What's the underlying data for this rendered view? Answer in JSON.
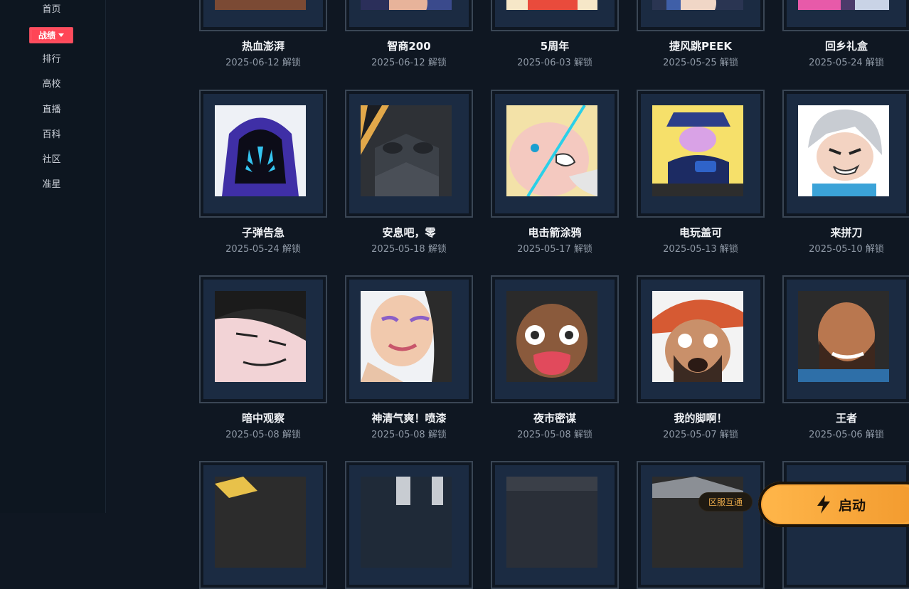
{
  "sidebar": {
    "items": [
      "首页",
      "战绩",
      "排行",
      "高校",
      "直播",
      "百科",
      "社区",
      "准星"
    ],
    "active": "战绩"
  },
  "cards": [
    {
      "title": "热血澎湃",
      "date": "2025-06-12 解锁",
      "icon": "portrait-brown"
    },
    {
      "title": "智商200",
      "date": "2025-06-12 解锁",
      "icon": "portrait-blue"
    },
    {
      "title": "5周年",
      "date": "2025-06-03 解锁",
      "icon": "portrait-cream"
    },
    {
      "title": "捷风跳PEEK",
      "date": "2025-05-25 解锁",
      "icon": "portrait-jett"
    },
    {
      "title": "回乡礼盒",
      "date": "2025-05-24 解锁",
      "icon": "portrait-pink"
    },
    {
      "title": "子弹告急",
      "date": "2025-05-24 解锁",
      "icon": "omen-hood"
    },
    {
      "title": "安息吧，零",
      "date": "2025-05-18 解锁",
      "icon": "masked-robot"
    },
    {
      "title": "电击箭涂鸦",
      "date": "2025-05-17 解锁",
      "icon": "shock-dart-blob"
    },
    {
      "title": "电玩盖可",
      "date": "2025-05-13 解锁",
      "icon": "gamer-gekko"
    },
    {
      "title": "来拼刀",
      "date": "2025-05-10 解锁",
      "icon": "white-hair-fighter"
    },
    {
      "title": "暗中观察",
      "date": "2025-05-08 解锁",
      "icon": "peeking-dark-hair"
    },
    {
      "title": "神清气爽！喷漆",
      "date": "2025-05-08 解锁",
      "icon": "relaxed-face"
    },
    {
      "title": "夜市密谋",
      "date": "2025-05-08 解锁",
      "icon": "shocked-face"
    },
    {
      "title": "我的脚啊！",
      "date": "2025-05-07 解锁",
      "icon": "crying-beret"
    },
    {
      "title": "王者",
      "date": "2025-05-06 解锁",
      "icon": "bearded-smile"
    }
  ],
  "bottom": {
    "region_label": "区服互通",
    "launch_label": "启动"
  },
  "colors": {
    "background": "#0f1722",
    "card_inner": "#1b2b42",
    "accent_red": "#ff4556",
    "launch_orange": "#f8a63a"
  }
}
